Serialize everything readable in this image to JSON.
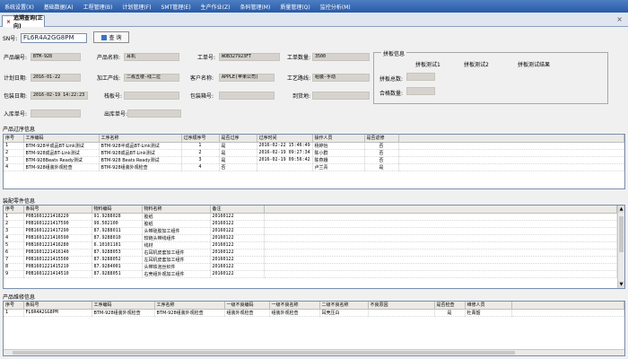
{
  "menu": [
    "系统设置(X)",
    "基础数据(A)",
    "工程管理(B)",
    "计划管理(F)",
    "SMT管理(E)",
    "生产作业(Z)",
    "条码管理(M)",
    "质量管理(Q)",
    "监控分析(M)"
  ],
  "tab": {
    "label": "追溯查询(正向)"
  },
  "sn": {
    "label": "SN号:",
    "value": "FL6R4A2GG8PM"
  },
  "query_button": "查 询",
  "fields": {
    "product_code": {
      "label": "产品编号:",
      "value": "BTM-928"
    },
    "product_name": {
      "label": "产品名称:",
      "value": "耳机"
    },
    "work_order_no": {
      "label": "工单号:",
      "value": "WOB327923FT"
    },
    "work_order_qty": {
      "label": "工单数量:",
      "value": "3500"
    },
    "plan_date": {
      "label": "计划日期:",
      "value": "2016-01-22"
    },
    "process_line": {
      "label": "加工产线:",
      "value": "二栋五楼-线二拉"
    },
    "customer_name": {
      "label": "客户名称:",
      "value": "APPLE(苹果公司)"
    },
    "process_route": {
      "label": "工艺路线:",
      "value": "组装-手动"
    },
    "pack_date": {
      "label": "包装日期:",
      "value": "2016-02-19 14:22:23"
    },
    "carton_no": {
      "label": "栈板号:",
      "value": ""
    },
    "box_no": {
      "label": "包装箱号:",
      "value": ""
    },
    "destination": {
      "label": "到货地:",
      "value": ""
    },
    "stock_in_no": {
      "label": "入库单号:",
      "value": ""
    },
    "stock_out_no": {
      "label": "出库单号:",
      "value": ""
    }
  },
  "split_info": {
    "title": "拼板信息",
    "col1": "拼板测试1",
    "col2": "拼板测试2",
    "col3": "拼板测试结果",
    "total_label": "拼板总数:",
    "pass_label": "合格数量:"
  },
  "process_section": {
    "title": "产品过序信息",
    "headers": [
      "序号",
      "工序编码",
      "工序名称",
      "过序顺序号",
      "是否过序",
      "过序时间",
      "操作人员",
      "是否返修"
    ],
    "rows": [
      [
        "1",
        "BTM-928半成品BT-Link测试",
        "BTM-928半成品BT-Link测试",
        "1",
        "是",
        "2016-02-22 15:46:49",
        "杨婷怡",
        "否"
      ],
      [
        "2",
        "BTM-928成品BT-Link测试",
        "BTM-928成品BT-Link测试",
        "2",
        "是",
        "2016-02-19 09:27:34",
        "陈小群",
        "否"
      ],
      [
        "3",
        "BTM-928Beats Ready测试",
        "BTM-928 Beats Ready测试",
        "3",
        "是",
        "2016-02-19 09:56:42",
        "陈燕娥",
        "否"
      ],
      [
        "4",
        "BTM-928组装外观检查",
        "BTM-928组装外观检查",
        "4",
        "否",
        "",
        "卢兰青",
        "是"
      ]
    ]
  },
  "material_section": {
    "title": "装配零件信息",
    "headers": [
      "序号",
      "条码号",
      "物料编码",
      "物料名称",
      "备注"
    ],
    "rows": [
      [
        "1",
        "P0B1601221418220",
        "91.9288028",
        "胶纸",
        "20160122"
      ],
      [
        "2",
        "P0B1601221417590",
        "99.502100",
        "胶纸",
        "20160122"
      ],
      [
        "3",
        "P0B1601221417290",
        "87.9288011",
        "头带硅胶加工组件",
        "20160122"
      ],
      [
        "4",
        "P0B1601221416590",
        "87.9288010",
        "较链头带线组件",
        "20160122"
      ],
      [
        "5",
        "P0B1601221416280",
        "6.10101101",
        "线材",
        "20160122"
      ],
      [
        "6",
        "P0B1601221416140",
        "87.9288053",
        "右耳机皮套加工组件",
        "20160122"
      ],
      [
        "7",
        "P0B1601221415500",
        "87.9288052",
        "左耳机皮套加工组件",
        "20160122"
      ],
      [
        "8",
        "P0B1601221415210",
        "87.9284001",
        "头带铁泡丝织件",
        "20160122"
      ],
      [
        "9",
        "P0B1601221414510",
        "87.9288051",
        "右壳组外观加工组件",
        "20160122"
      ]
    ]
  },
  "repair_section": {
    "title": "产品维修信息",
    "headers": [
      "序号",
      "条码号",
      "工序编码",
      "工序名称",
      "一级不良编码",
      "一级不良名称",
      "二级不良名称",
      "不良原因",
      "是否检查",
      "维修人员"
    ],
    "rows": [
      [
        "1",
        "FL6R4A2GG8PM",
        "BTM-928组装外观检查",
        "BTM-928组装外观检查",
        "组装外观检查",
        "组装外观检查",
        "耳壳压白",
        "",
        "是",
        "杜菁韶"
      ]
    ]
  }
}
